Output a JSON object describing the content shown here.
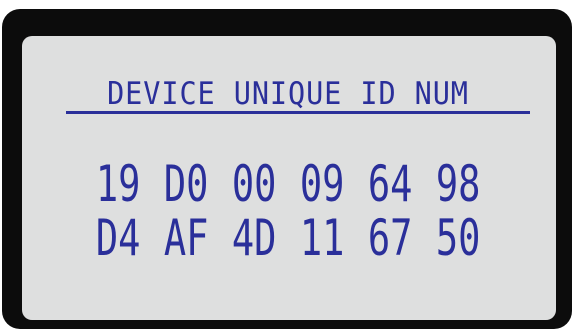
{
  "display": {
    "title": "DEVICE UNIQUE ID NUM",
    "id_rows": [
      [
        "19",
        "D0",
        "00",
        "09",
        "64",
        "98"
      ],
      [
        "D4",
        "AF",
        "4D",
        "11",
        "67",
        "50"
      ]
    ]
  },
  "colors": {
    "bezel": "#0c0c0c",
    "screen_background": "#dedfdf",
    "text": "#2a2f9a"
  }
}
